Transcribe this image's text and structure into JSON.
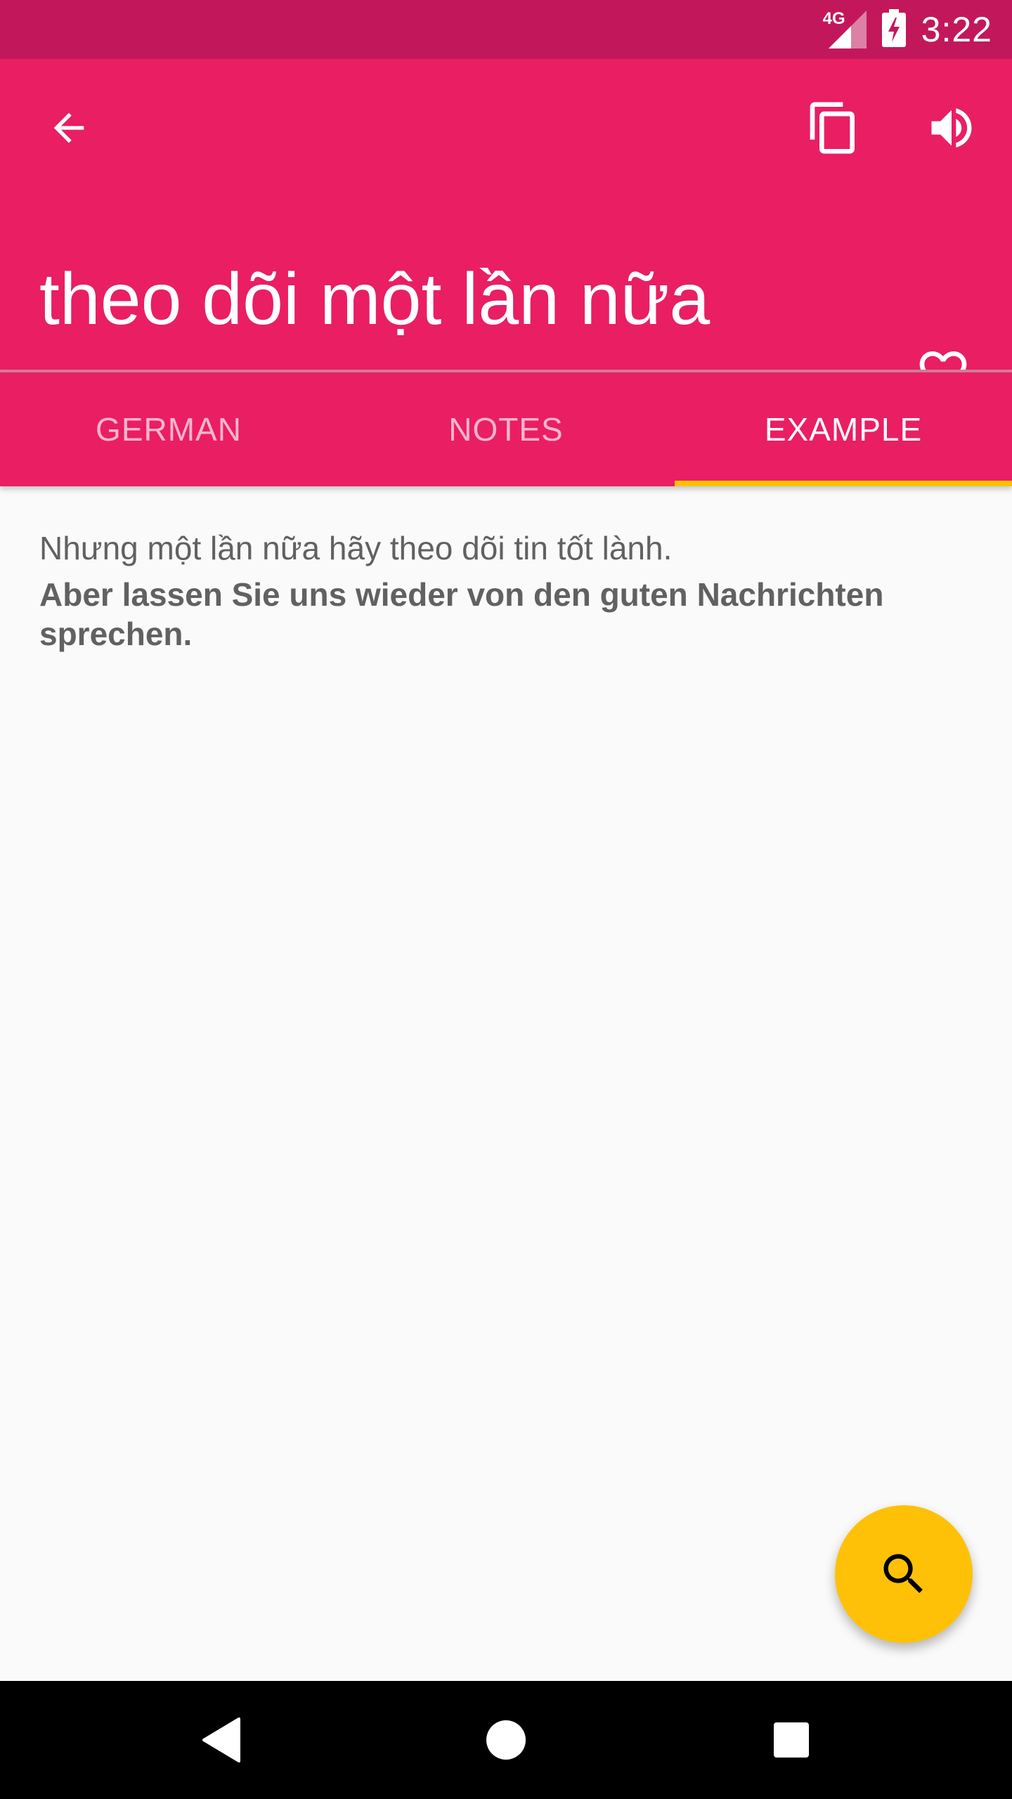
{
  "status_bar": {
    "network": "4G",
    "time": "3:22"
  },
  "app_bar": {
    "title": "theo dõi một lần nữa",
    "icons": [
      "arrow-back-icon",
      "copy-icon",
      "volume-up-icon",
      "heart-outline-icon"
    ]
  },
  "tabs": [
    {
      "label": "GERMAN",
      "active": false
    },
    {
      "label": "NOTES",
      "active": false
    },
    {
      "label": "EXAMPLE",
      "active": true
    }
  ],
  "example": {
    "source": "Nhưng một lần nữa hãy theo dõi tin tốt lành.",
    "translation": "Aber lassen Sie uns wieder von den guten Nachrichten sprechen."
  },
  "fab": {
    "icon": "search-icon"
  },
  "nav_bar": {
    "icons": [
      "nav-back-icon",
      "nav-home-icon",
      "nav-recents-icon"
    ]
  },
  "colors": {
    "primary": "#e91e63",
    "primary_dark": "#c2185b",
    "accent": "#ffc107",
    "background": "#fafafa",
    "text": "#616161"
  }
}
